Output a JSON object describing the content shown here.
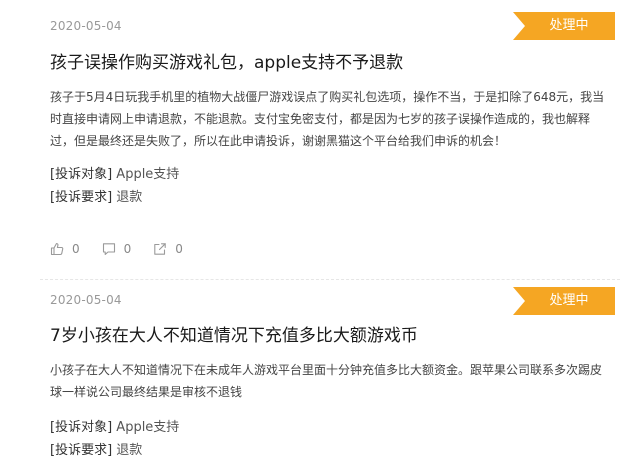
{
  "colors": {
    "status_badge": "#f5a623",
    "date_text": "#999999",
    "title_text": "#1a1a1a"
  },
  "complaints": [
    {
      "date": "2020-05-04",
      "status": "处理中",
      "title": "孩子误操作购买游戏礼包，apple支持不予退款",
      "description": "孩子于5月4日玩我手机里的植物大战僵尸游戏误点了购买礼包选项，操作不当，于是扣除了648元，我当时直接申请网上申请退款，不能退款。支付宝免密支付，都是因为七岁的孩子误操作造成的，我也解释过，但是最终还是失败了，所以在此申请投诉，谢谢黑猫这个平台给我们申诉的机会！",
      "target_label": "[投诉对象]",
      "target_value": "Apple支持",
      "demand_label": "[投诉要求]",
      "demand_value": "退款",
      "likes": "0",
      "comments": "0",
      "shares": "0",
      "icons": [
        "thumbs-up-icon",
        "comment-icon",
        "share-icon"
      ]
    },
    {
      "date": "2020-05-04",
      "status": "处理中",
      "title": "7岁小孩在大人不知道情况下充值多比大额游戏币",
      "description": "小孩子在大人不知道情况下在未成年人游戏平台里面十分钟充值多比大额资金。跟苹果公司联系多次踢皮球一样说公司最终结果是审核不退钱",
      "target_label": "[投诉对象]",
      "target_value": "Apple支持",
      "demand_label": "[投诉要求]",
      "demand_value": "退款"
    }
  ]
}
